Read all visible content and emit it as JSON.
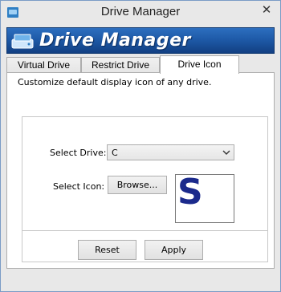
{
  "window": {
    "title": "Drive Manager",
    "close_glyph": "✕"
  },
  "banner": {
    "title": "Drive Manager",
    "icon": "drive-icon",
    "color": "#1e5aa8"
  },
  "tabs": [
    {
      "label": "Virtual Drive",
      "active": false
    },
    {
      "label": "Restrict Drive",
      "active": false
    },
    {
      "label": "Drive Icon",
      "active": true
    }
  ],
  "panel": {
    "description": "Customize default display icon of any drive.",
    "select_drive_label": "Select Drive:",
    "select_drive_value": "C",
    "select_icon_label": "Select Icon:",
    "browse_label": "Browse...",
    "icon_preview_glyph": "S",
    "reset_label": "Reset",
    "apply_label": "Apply"
  }
}
